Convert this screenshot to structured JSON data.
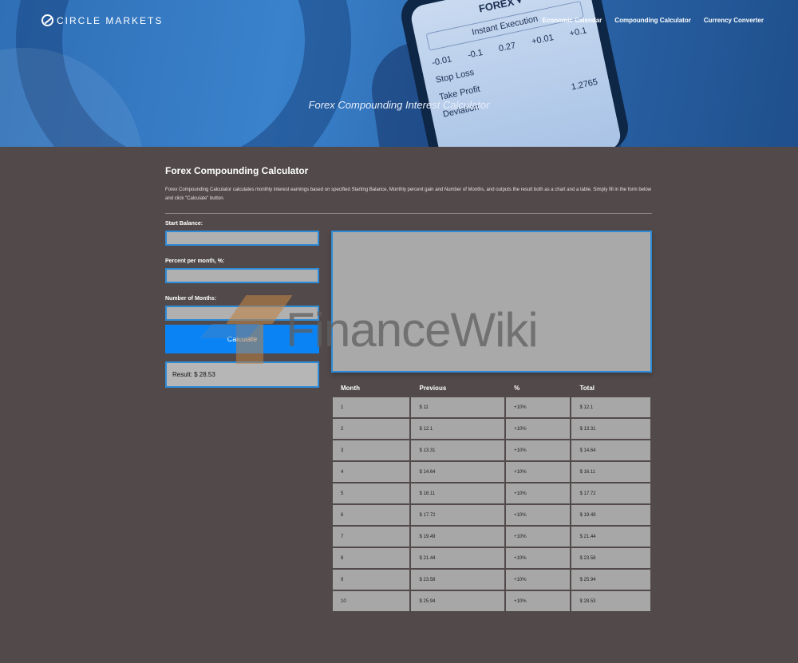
{
  "header": {
    "logo_icon": "circle-slash-icon",
    "logo_text": "CIRCLE MARKETS",
    "nav": [
      {
        "label": "Economic Calendar"
      },
      {
        "label": "Compounding Calculator"
      },
      {
        "label": "Currency Converter"
      }
    ]
  },
  "hero": {
    "title": "Forex Compounding Interest Calculator",
    "phone": {
      "forex": "FOREX ▾",
      "instant": "Instant Execution",
      "nums": [
        "-0.01",
        "-0.1",
        "0.27",
        "+0.01",
        "+0.1"
      ],
      "stop_loss": "Stop Loss",
      "take_profit": "Take Profit",
      "deviation": "Deviation",
      "price": "1.2765"
    }
  },
  "main": {
    "title": "Forex Compounding Calculator",
    "description": "Forex Compounding Calculator calculates monthly interest earnings based on specified Starting Balance, Monthly percent gain and Number of Months, and outputs the result both as a chart and a table. Simply fill in the form below and click \"Calculate\" button."
  },
  "form": {
    "start_balance_label": "Start Balance:",
    "percent_label": "Percent per month, %:",
    "months_label": "Number of Months:",
    "start_balance_value": "",
    "percent_value": "",
    "months_value": "",
    "calculate_label": "Calculate",
    "result_text": "Result: $ 28.53"
  },
  "watermark": {
    "text": "FinanceWiki"
  },
  "table": {
    "headers": [
      "Month",
      "Previous",
      "%",
      "Total"
    ],
    "rows": [
      [
        "1",
        "$ 11",
        "+10%",
        "$ 12.1"
      ],
      [
        "2",
        "$ 12.1",
        "+10%",
        "$ 13.31"
      ],
      [
        "3",
        "$ 13.31",
        "+10%",
        "$ 14.64"
      ],
      [
        "4",
        "$ 14.64",
        "+10%",
        "$ 16.11"
      ],
      [
        "5",
        "$ 16.11",
        "+10%",
        "$ 17.72"
      ],
      [
        "6",
        "$ 17.72",
        "+10%",
        "$ 19.49"
      ],
      [
        "7",
        "$ 19.49",
        "+10%",
        "$ 21.44"
      ],
      [
        "8",
        "$ 21.44",
        "+10%",
        "$ 23.58"
      ],
      [
        "9",
        "$ 23.58",
        "+10%",
        "$ 25.94"
      ],
      [
        "10",
        "$ 25.94",
        "+10%",
        "$ 28.53"
      ]
    ]
  },
  "colors": {
    "background": "#524a4a",
    "accent": "#0a84f5",
    "input_border": "#2e8bd8",
    "cell_bg": "#a7a7a7"
  }
}
